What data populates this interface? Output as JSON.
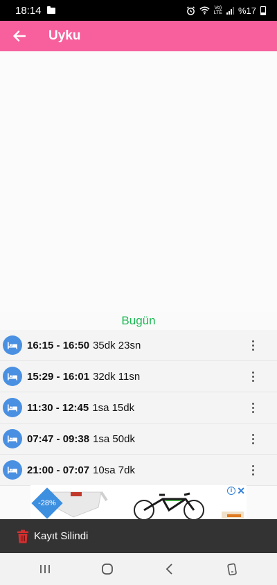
{
  "status_bar": {
    "time": "18:14",
    "volte": "Vo)\nLTE",
    "battery": "%17"
  },
  "app_bar": {
    "title": "Uyku",
    "back_icon": "arrow-left-icon"
  },
  "section": {
    "header": "Bugün"
  },
  "sleep_entries": [
    {
      "range": "16:15 - 16:50",
      "duration": "35dk 23sn"
    },
    {
      "range": "15:29 - 16:01",
      "duration": "32dk 11sn"
    },
    {
      "range": "11:30 - 12:45",
      "duration": "1sa 15dk"
    },
    {
      "range": "07:47 - 09:38",
      "duration": "1sa 50dk"
    },
    {
      "range": "21:00 - 07:07",
      "duration": "10sa 7dk"
    }
  ],
  "ad": {
    "discount": "-28%"
  },
  "snackbar": {
    "message": "Kayıt Silindi"
  },
  "colors": {
    "app_bar": "#f7609c",
    "header_green": "#1db954",
    "icon_blue": "#4a90e2",
    "snackbar": "#333333",
    "trash_red": "#d32f2f"
  }
}
